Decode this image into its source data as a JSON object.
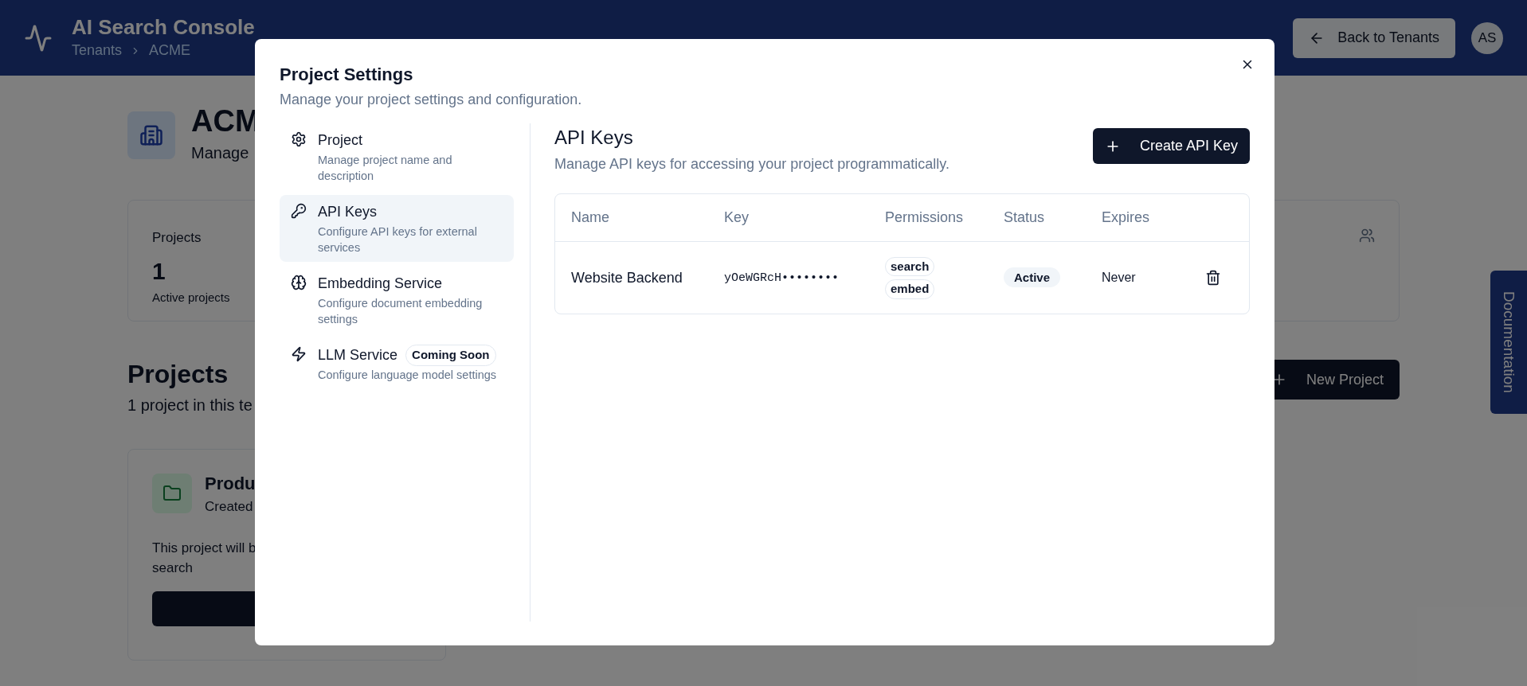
{
  "header": {
    "title": "AI Search Console",
    "breadcrumbs": [
      "Tenants",
      "ACME"
    ],
    "back_button": "Back to Tenants",
    "avatar": "AS"
  },
  "page": {
    "tenant_title": "ACM",
    "tenant_subtitle": "Manage",
    "stats_card": {
      "label": "Projects",
      "value": "1",
      "caption": "Active projects"
    },
    "section_title": "Projects",
    "section_subtitle": "1 project in this te",
    "new_project_button": "New Project",
    "project_card": {
      "name": "Produ",
      "meta": "Created",
      "description_lines": [
        "This project will b",
        "search"
      ]
    },
    "documentation_tab": "Documentation"
  },
  "modal": {
    "title": "Project Settings",
    "subtitle": "Manage your project settings and configuration.",
    "nav": [
      {
        "kind": "gear",
        "label": "Project",
        "description": "Manage project name and description",
        "selected": false
      },
      {
        "kind": "key",
        "label": "API Keys",
        "description": "Configure API keys for external services",
        "selected": true
      },
      {
        "kind": "brain",
        "label": "Embedding Service",
        "description": "Configure document embedding settings",
        "selected": false
      },
      {
        "kind": "bolt",
        "label": "LLM Service",
        "badge": "Coming Soon",
        "description": "Configure language model settings",
        "selected": false
      }
    ],
    "content": {
      "title": "API Keys",
      "subtitle": "Manage API keys for accessing your project programmatically.",
      "create_button": "Create API Key",
      "table": {
        "columns": [
          "Name",
          "Key",
          "Permissions",
          "Status",
          "Expires"
        ],
        "rows": [
          {
            "name": "Website Backend",
            "key": "yOeWGRcH••••••••",
            "permissions": [
              "search",
              "embed"
            ],
            "status": "Active",
            "expires": "Never"
          }
        ]
      }
    }
  }
}
